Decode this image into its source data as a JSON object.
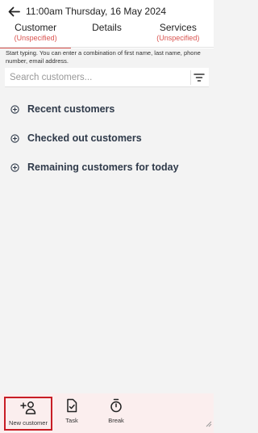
{
  "header": {
    "back_icon": "arrow-left-icon",
    "title": "11:00am Thursday, 16 May 2024"
  },
  "tabs": [
    {
      "label": "Customer",
      "sub": "(Unspecified)",
      "active": true
    },
    {
      "label": "Details",
      "sub": "",
      "active": false
    },
    {
      "label": "Services",
      "sub": "(Unspecified)",
      "active": false
    }
  ],
  "search": {
    "hint": "Start typing. You can enter a combination of first name, last name, phone number, email address.",
    "placeholder": "Search customers...",
    "value": "",
    "filter_icon": "filter-icon"
  },
  "sections": [
    {
      "icon": "plus-circle-icon",
      "title": "Recent customers"
    },
    {
      "icon": "plus-circle-icon",
      "title": "Checked out customers"
    },
    {
      "icon": "plus-circle-icon",
      "title": "Remaining customers for today"
    }
  ],
  "bottom_bar": [
    {
      "icon": "add-person-icon",
      "label": "New customer",
      "selected": true
    },
    {
      "icon": "task-icon",
      "label": "Task",
      "selected": false
    },
    {
      "icon": "stopwatch-icon",
      "label": "Break",
      "selected": false
    }
  ],
  "colors": {
    "accent": "#d9534f",
    "highlight_border": "#c81d25",
    "bottom_bar_bg": "#fbeeee",
    "section_text": "#2f3a4a"
  }
}
